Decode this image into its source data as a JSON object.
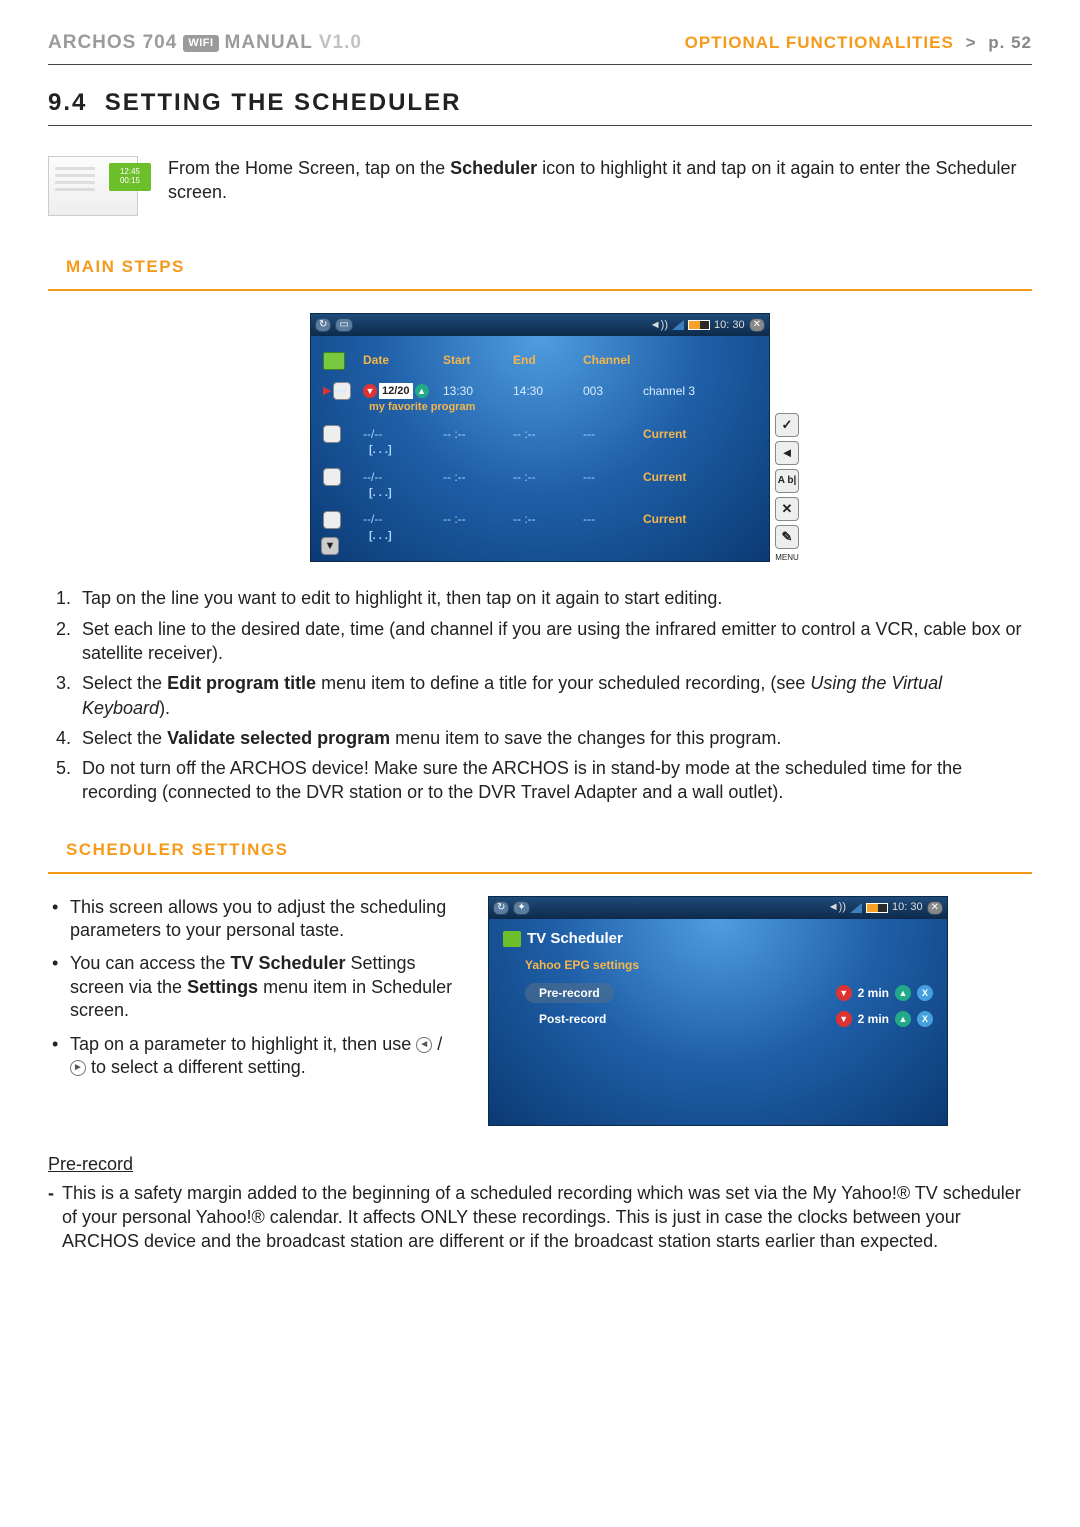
{
  "header": {
    "brand": "ARCHOS 704",
    "wifi": "WIFI",
    "manual": "MANUAL",
    "version": "V1.0",
    "section_name": "OPTIONAL FUNCTIONALITIES",
    "caret": ">",
    "page": "p. 52"
  },
  "section": {
    "number": "9.4",
    "title": "SETTING THE SCHEDULER"
  },
  "intro": {
    "badge_l1": "12:45",
    "badge_l2": "00:15",
    "text_pre": "From the Home Screen, tap on the ",
    "text_bold": "Scheduler",
    "text_post": " icon to highlight it and tap on it again to enter the Scheduler screen."
  },
  "main_steps_title": "MAIN STEPS",
  "shot1": {
    "clock": "10: 30",
    "headers": {
      "date": "Date",
      "start": "Start",
      "end": "End",
      "channel": "Channel"
    },
    "first": {
      "date": "12/20",
      "start": "13:30",
      "end": "14:30",
      "chnum": "003",
      "chname": "channel 3",
      "title": "my favorite program"
    },
    "blank": {
      "date": "--/--",
      "time": "-- :--",
      "dash": "---",
      "cur": "Current",
      "title": "[. . .]"
    },
    "side": {
      "ok": "✓",
      "back": "◄",
      "kb": "A b|",
      "close": "✕",
      "tool": "✎",
      "menu": "MENU"
    }
  },
  "steps": {
    "s1": "Tap on the line you want to edit to highlight it, then tap on it again to start editing.",
    "s2": "Set each line to the desired date, time (and channel if you are using the infrared emitter to control a VCR, cable box or satellite receiver).",
    "s3_a": "Select the ",
    "s3_b": "Edit program title",
    "s3_c": " menu item to define a title for your scheduled recording, (see ",
    "s3_d": "Using the Virtual Keyboard",
    "s3_e": ").",
    "s4_a": "Select the ",
    "s4_b": "Validate selected program",
    "s4_c": " menu item to save the changes for this program.",
    "s5": "Do not turn off the ARCHOS device! Make sure the ARCHOS is in stand-by mode at the scheduled time for the recording (connected to the DVR station or to the DVR Travel Adapter and a wall outlet)."
  },
  "scheduler_settings_title": "SCHEDULER SETTINGS",
  "settings_bullets": {
    "b1": "This screen allows you to adjust the scheduling parameters to your personal taste.",
    "b2_a": "You can access the ",
    "b2_b": "TV Scheduler",
    "b2_c": " Settings screen via the ",
    "b2_d": "Settings",
    "b2_e": " menu item in Scheduler screen.",
    "b3_a": "Tap on a parameter to highlight it, then use ",
    "b3_b": " / ",
    "b3_c": " to select a different setting."
  },
  "shot2": {
    "clock": "10: 30",
    "title": "TV Scheduler",
    "yahoo": "Yahoo EPG settings",
    "pre": "Pre-record",
    "post": "Post-record",
    "val": "2 min"
  },
  "prerecord": {
    "heading": "Pre-record",
    "text": "This is a safety margin added to the beginning of a scheduled recording which was set via the My Yahoo!® TV scheduler of your personal Yahoo!® calendar. It affects ONLY these recordings. This is just in case the clocks between your ARCHOS device and the broadcast station are different or if the broadcast station starts earlier than expected."
  }
}
